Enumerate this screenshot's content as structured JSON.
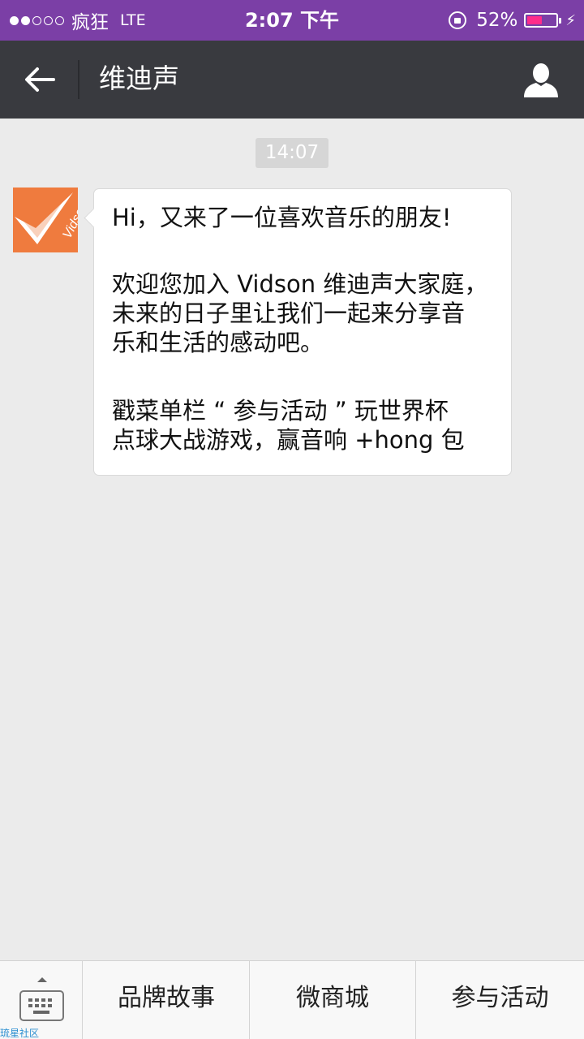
{
  "status_bar": {
    "signal_bars": 2,
    "signal_total": 5,
    "carrier": "疯狂",
    "network": "LTE",
    "time": "2:07 下午",
    "battery": "52%",
    "battery_level": 0.52,
    "battery_color": "#ff2d8a",
    "icons": [
      "rotation-lock-icon",
      "battery-icon",
      "charging-bolt-icon"
    ]
  },
  "header": {
    "title": "维迪声",
    "back_icon": "arrow-left-icon",
    "profile_icon": "person-icon",
    "background": "#393a3f"
  },
  "chat": {
    "timestamp": "14:07",
    "message": {
      "avatar_text": "Vidson",
      "avatar_color": "#ef7b3e",
      "paragraphs": [
        [
          "Hi，又来了一位喜欢音乐的朋友!"
        ],
        [
          "欢迎您加入 Vidson 维迪声大家庭，",
          "未来的日子里让我们一起来分享音",
          "乐和生活的感动吧。"
        ],
        [
          "戳菜单栏 “ 参与活动 ” 玩世界杯",
          "点球大战游戏，赢音响 +hong 包"
        ]
      ]
    }
  },
  "menu": {
    "keyboard_icon": "keyboard-icon",
    "items": [
      "品牌故事",
      "微商城",
      "参与活动"
    ]
  },
  "watermark": "琉星社区"
}
